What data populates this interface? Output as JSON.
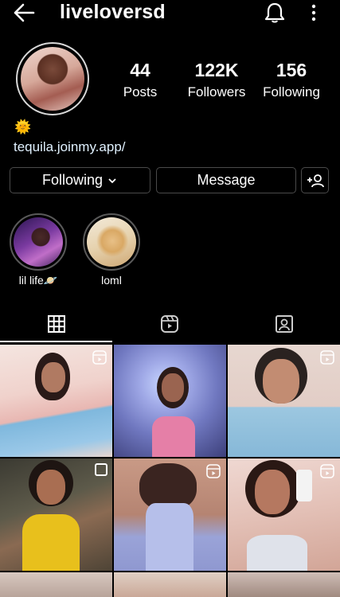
{
  "header": {
    "username": "liveloversd",
    "back_icon": "arrow-left-icon",
    "bell_icon": "bell-icon",
    "more_icon": "more-vertical-icon"
  },
  "stats": [
    {
      "value": "44",
      "label": "Posts"
    },
    {
      "value": "122K",
      "label": "Followers"
    },
    {
      "value": "156",
      "label": "Following"
    }
  ],
  "bio": {
    "emoji": "🌞",
    "link": "tequila.joinmy.app/"
  },
  "buttons": {
    "following": "Following",
    "message": "Message",
    "add_person_icon": "add-person-icon"
  },
  "highlights": [
    {
      "label": "lil life🪐"
    },
    {
      "label": "loml"
    }
  ],
  "tabs": [
    "grid-icon",
    "reels-icon",
    "tagged-icon"
  ],
  "grid": [
    {
      "reel": true
    },
    {
      "reel": false
    },
    {
      "reel": true
    },
    {
      "reel": false
    },
    {
      "reel": true
    },
    {
      "reel": true
    }
  ],
  "colors": {
    "background": "#000000",
    "text": "#ffffff",
    "border": "#4a4a4a",
    "link": "#e0f1ff"
  }
}
